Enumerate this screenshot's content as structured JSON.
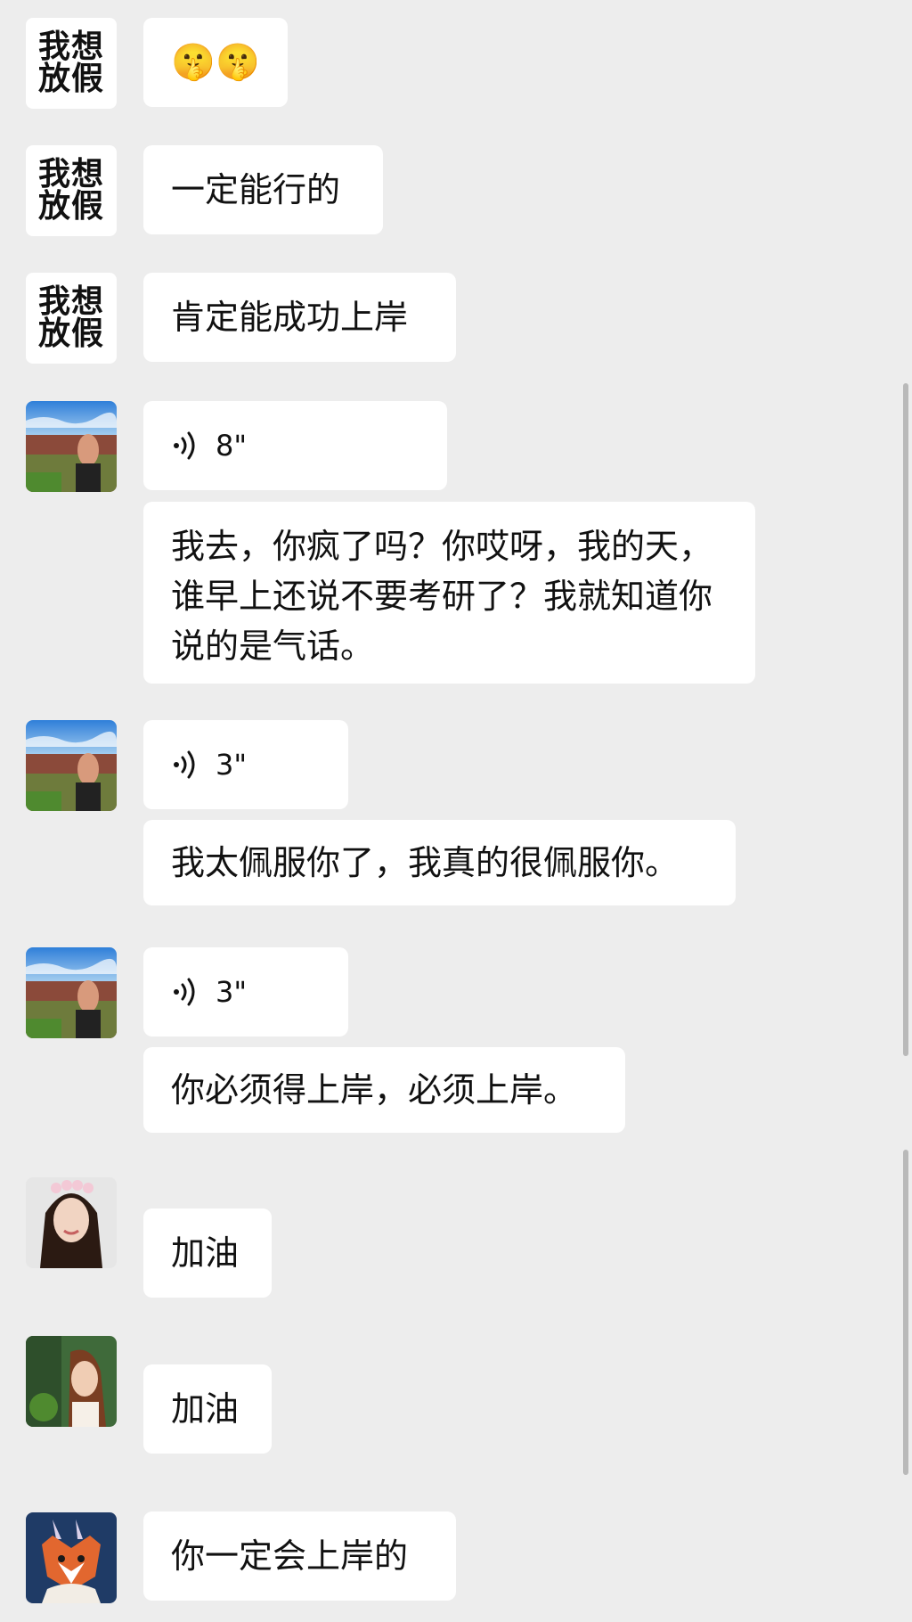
{
  "messages": [
    {
      "sender": "我想放假",
      "content": "emoji",
      "emoji": "🤫🤫"
    },
    {
      "sender": "我想放假",
      "content": "一定能行的"
    },
    {
      "sender": "我想放假",
      "content": "肯定能成功上岸"
    },
    {
      "voice": "8\"",
      "content": "我去，你疯了吗？你哎呀，我的天，谁早上还说不要考研了？我就知道你说的是气话。"
    },
    {
      "voice": "3\"",
      "content": "我太佩服你了，我真的很佩服你。"
    },
    {
      "voice": "3\"",
      "content": "你必须得上岸，必须上岸。"
    },
    {
      "content": "加油"
    },
    {
      "content": "加油"
    },
    {
      "content": "你一定会上岸的"
    }
  ],
  "text_avatar_lines": [
    "我想",
    "放假"
  ],
  "icons": {
    "voice": "voice-wave-icon"
  },
  "colors": {
    "background": "#ededed",
    "bubble": "#ffffff",
    "text": "#111111"
  }
}
